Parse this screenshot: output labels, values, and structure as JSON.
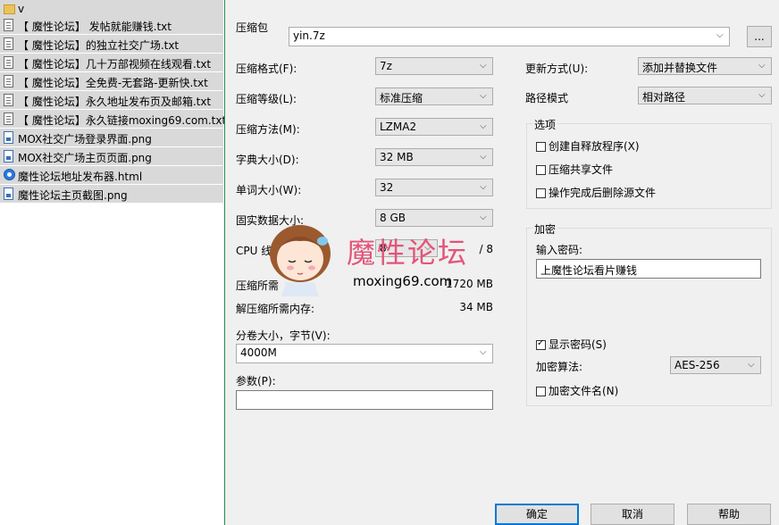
{
  "files": [
    {
      "name": "v",
      "icon": "folder"
    },
    {
      "name": "【 魔性论坛】 发帖就能赚钱.txt",
      "icon": "txt"
    },
    {
      "name": "【 魔性论坛】的独立社交广场.txt",
      "icon": "txt"
    },
    {
      "name": "【 魔性论坛】几十万部视频在线观看.txt",
      "icon": "txt"
    },
    {
      "name": "【 魔性论坛】全免费-无套路-更新快.txt",
      "icon": "txt"
    },
    {
      "name": "【 魔性论坛】永久地址发布页及邮箱.txt",
      "icon": "txt"
    },
    {
      "name": "【 魔性论坛】永久链接moxing69.com.txt",
      "icon": "txt"
    },
    {
      "name": "MOX社交广场登录界面.png",
      "icon": "png"
    },
    {
      "name": "MOX社交广场主页页面.png",
      "icon": "png"
    },
    {
      "name": "魔性论坛地址发布器.html",
      "icon": "html"
    },
    {
      "name": "魔性论坛主页截图.png",
      "icon": "png"
    }
  ],
  "dialog": {
    "archive_label": "压缩包",
    "archive_value": "yin.7z",
    "browse_label": "...",
    "format_label": "压缩格式(F):",
    "format_value": "7z",
    "level_label": "压缩等级(L):",
    "level_value": "标准压缩",
    "method_label": "压缩方法(M):",
    "method_value": "LZMA2",
    "dict_label": "字典大小(D):",
    "dict_value": "32 MB",
    "word_label": "单词大小(W):",
    "word_value": "32",
    "solid_label": "固实数据大小:",
    "solid_value": "8 GB",
    "cpu_label": "CPU 线",
    "cpu_value": "8",
    "cpu_total": "/ 8",
    "mem_comp_label": "压缩所需",
    "mem_comp_value": "1720 MB",
    "mem_decomp_label": "解压缩所需内存:",
    "mem_decomp_value": "34 MB",
    "split_label": "分卷大小，字节(V):",
    "split_value": "4000M",
    "params_label": "参数(P):",
    "params_value": "",
    "update_label": "更新方式(U):",
    "update_value": "添加并替换文件",
    "path_label": "路径模式",
    "path_value": "相对路径",
    "options_title": "选项",
    "opt_sfx": "创建自释放程序(X)",
    "opt_shared": "压缩共享文件",
    "opt_delete": "操作完成后删除源文件",
    "encrypt_title": "加密",
    "password_label": "输入密码:",
    "password_value": "上魔性论坛看片赚钱",
    "show_password": "显示密码(S)",
    "algo_label": "加密算法:",
    "algo_value": "AES-256",
    "encrypt_names": "加密文件名(N)",
    "ok": "确定",
    "cancel": "取消",
    "help": "帮助"
  },
  "watermark": {
    "title": "魔性论坛",
    "url": "moxing69.com"
  },
  "colors": {
    "file_row_bg": "#d9d9d9",
    "dialog_bg": "#f0f0f0",
    "watermark_pink": "#e3547a",
    "default_button_border": "#0078d7"
  }
}
